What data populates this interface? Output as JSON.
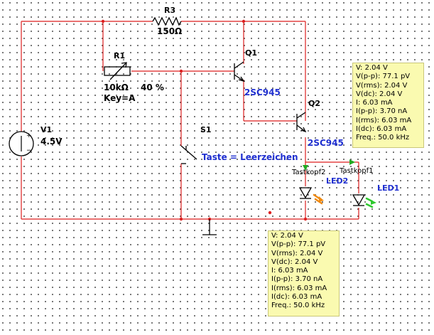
{
  "components": {
    "R3": {
      "name": "R3",
      "value": "150Ω"
    },
    "R1": {
      "name": "R1",
      "value": "10kΩ",
      "percent": "40 %",
      "key": "Key=A"
    },
    "Q1": {
      "name": "Q1",
      "model": "2SC945"
    },
    "Q2": {
      "name": "Q2",
      "model": "2SC945"
    },
    "V1": {
      "name": "V1",
      "value": "4.5V"
    },
    "S1": {
      "name": "S1",
      "key": "Taste = Leerzeichen"
    },
    "LED1": {
      "name": "LED1"
    },
    "LED2": {
      "name": "LED2"
    }
  },
  "probes": {
    "tastkopf1": {
      "label": "Tastkopf1"
    },
    "tastkopf2": {
      "label": "Tastkopf2"
    }
  },
  "measure_top": {
    "lines": [
      "V: 2.04 V",
      "V(p-p): 77.1 pV",
      "V(rms): 2.04 V",
      "V(dc): 2.04 V",
      "I: 6.03 mA",
      "I(p-p): 3.70 nA",
      "I(rms): 6.03 mA",
      "I(dc): 6.03 mA",
      "Freq.: 50.0 kHz"
    ]
  },
  "measure_bottom": {
    "lines": [
      "V: 2.04 V",
      "V(p-p): 77.1 pV",
      "V(rms): 2.04 V",
      "V(dc): 2.04 V",
      "I: 6.03 mA",
      "I(p-p): 3.70 nA",
      "I(rms): 6.03 mA",
      "I(dc): 6.03 mA",
      "Freq.: 50.0 kHz"
    ]
  },
  "colors": {
    "wire": "#dd1f1f",
    "component": "#000000",
    "label_blue": "#1f2fd0",
    "probe_green": "#22aa22",
    "led_orange": "#f08a10",
    "led_green": "#2dc82d",
    "measure_box": "#fafab0"
  }
}
